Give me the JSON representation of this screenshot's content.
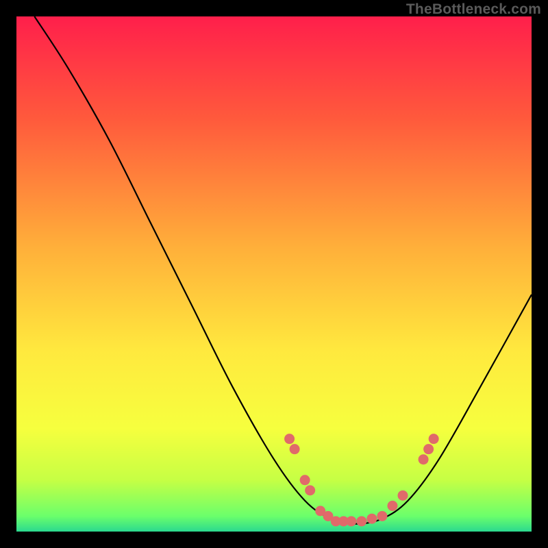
{
  "attribution": "TheBottleneck.com",
  "chart_data": {
    "type": "line",
    "title": "",
    "xlabel": "",
    "ylabel": "",
    "xlim": [
      0,
      100
    ],
    "ylim": [
      0,
      100
    ],
    "gradient_stops": [
      {
        "offset": 0,
        "color": "#ff1f4b"
      },
      {
        "offset": 20,
        "color": "#ff5a3c"
      },
      {
        "offset": 45,
        "color": "#ffb03a"
      },
      {
        "offset": 65,
        "color": "#ffe93e"
      },
      {
        "offset": 80,
        "color": "#f6ff3e"
      },
      {
        "offset": 90,
        "color": "#c6ff44"
      },
      {
        "offset": 97,
        "color": "#6bff6b"
      },
      {
        "offset": 100,
        "color": "#2bd98f"
      }
    ],
    "series": [
      {
        "name": "bottleneck-curve",
        "points": [
          {
            "x": 3.5,
            "y": 100
          },
          {
            "x": 10,
            "y": 90
          },
          {
            "x": 18,
            "y": 76
          },
          {
            "x": 26,
            "y": 60
          },
          {
            "x": 34,
            "y": 44
          },
          {
            "x": 42,
            "y": 28
          },
          {
            "x": 50,
            "y": 14
          },
          {
            "x": 56,
            "y": 6
          },
          {
            "x": 61,
            "y": 2.5
          },
          {
            "x": 66,
            "y": 1.5
          },
          {
            "x": 71,
            "y": 2.5
          },
          {
            "x": 76,
            "y": 6
          },
          {
            "x": 82,
            "y": 14
          },
          {
            "x": 90,
            "y": 28
          },
          {
            "x": 100,
            "y": 46
          }
        ]
      }
    ],
    "markers": [
      {
        "x": 53,
        "y": 18
      },
      {
        "x": 54,
        "y": 16
      },
      {
        "x": 56,
        "y": 10
      },
      {
        "x": 57,
        "y": 8
      },
      {
        "x": 59,
        "y": 4
      },
      {
        "x": 60.5,
        "y": 3
      },
      {
        "x": 62,
        "y": 2
      },
      {
        "x": 63.5,
        "y": 2
      },
      {
        "x": 65,
        "y": 2
      },
      {
        "x": 67,
        "y": 2
      },
      {
        "x": 69,
        "y": 2.5
      },
      {
        "x": 71,
        "y": 3
      },
      {
        "x": 73,
        "y": 5
      },
      {
        "x": 75,
        "y": 7
      },
      {
        "x": 79,
        "y": 14
      },
      {
        "x": 80,
        "y": 16
      },
      {
        "x": 81,
        "y": 18
      }
    ],
    "marker_color": "#e06a6a",
    "curve_color": "#000000"
  }
}
